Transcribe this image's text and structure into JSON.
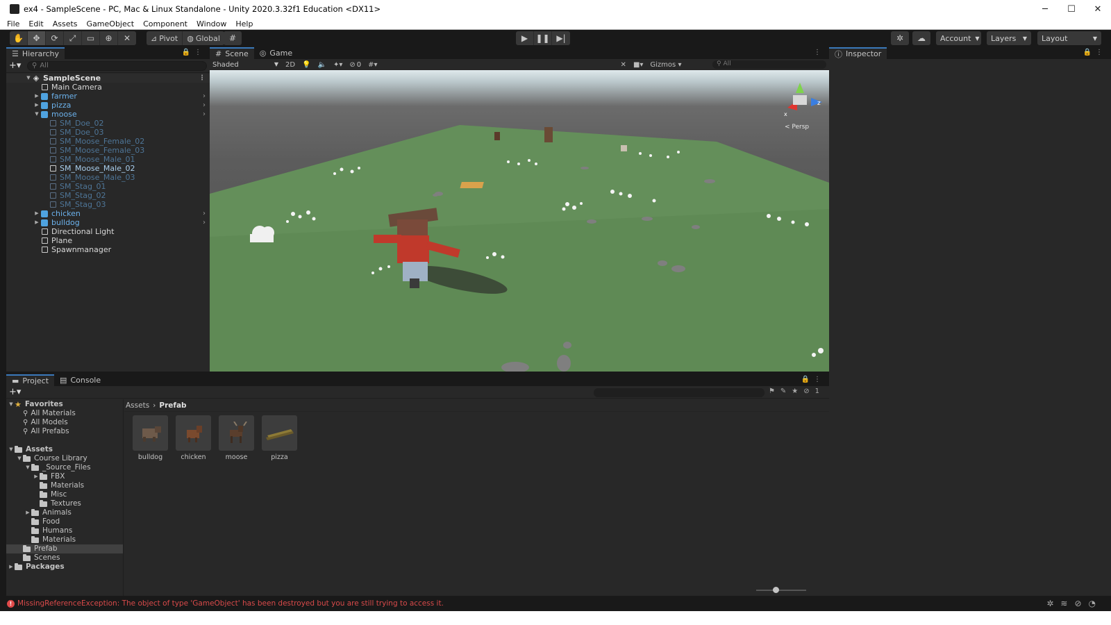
{
  "window": {
    "title": "ex4 - SampleScene - PC, Mac & Linux Standalone - Unity 2020.3.32f1 Education <DX11>",
    "controls": [
      "─",
      "☐",
      "✕"
    ]
  },
  "menubar": [
    "File",
    "Edit",
    "Assets",
    "GameObject",
    "Component",
    "Window",
    "Help"
  ],
  "toolbar": {
    "pivot_label": "Pivot",
    "global_label": "Global",
    "account_label": "Account",
    "layers_label": "Layers",
    "layout_label": "Layout"
  },
  "hierarchy": {
    "tab_label": "Hierarchy",
    "search_placeholder": "All",
    "scene_name": "SampleScene",
    "items": [
      {
        "label": "Main Camera",
        "style": "white"
      },
      {
        "label": "farmer",
        "style": "blue"
      },
      {
        "label": "pizza",
        "style": "blue"
      },
      {
        "label": "moose",
        "style": "blue"
      },
      {
        "label": "SM_Doe_02",
        "style": "faded"
      },
      {
        "label": "SM_Doe_03",
        "style": "faded"
      },
      {
        "label": "SM_Moose_Female_02",
        "style": "faded"
      },
      {
        "label": "SM_Moose_Female_03",
        "style": "faded"
      },
      {
        "label": "SM_Moose_Male_01",
        "style": "faded"
      },
      {
        "label": "SM_Moose_Male_02",
        "style": "bright"
      },
      {
        "label": "SM_Moose_Male_03",
        "style": "faded"
      },
      {
        "label": "SM_Stag_01",
        "style": "faded"
      },
      {
        "label": "SM_Stag_02",
        "style": "faded"
      },
      {
        "label": "SM_Stag_03",
        "style": "faded"
      },
      {
        "label": "chicken",
        "style": "blue"
      },
      {
        "label": "bulldog",
        "style": "blue"
      },
      {
        "label": "Directional Light",
        "style": "white"
      },
      {
        "label": "Plane",
        "style": "white"
      },
      {
        "label": "Spawnmanager",
        "style": "white"
      }
    ]
  },
  "scene": {
    "tabs": [
      "Scene",
      "Game"
    ],
    "shading_mode": "Shaded",
    "mode_2d": "2D",
    "hidden_count": "0",
    "gizmos_label": "Gizmos",
    "search_placeholder": "All",
    "projection_label": "< Persp",
    "axis_labels": {
      "x": "x",
      "z": "z"
    }
  },
  "inspector": {
    "tab_label": "Inspector"
  },
  "project": {
    "tabs": [
      "Project",
      "Console"
    ],
    "badge_count": "1",
    "favorites_label": "Favorites",
    "favorites": [
      "All Materials",
      "All Models",
      "All Prefabs"
    ],
    "assets_label": "Assets",
    "folders": [
      {
        "label": "Course Library",
        "depth": 1,
        "arrow": "open"
      },
      {
        "label": "_Source_Files",
        "depth": 2,
        "arrow": "open"
      },
      {
        "label": "FBX",
        "depth": 3,
        "arrow": "closed"
      },
      {
        "label": "Materials",
        "depth": 3,
        "arrow": "none"
      },
      {
        "label": "Misc",
        "depth": 3,
        "arrow": "none"
      },
      {
        "label": "Textures",
        "depth": 3,
        "arrow": "none"
      },
      {
        "label": "Animals",
        "depth": 2,
        "arrow": "closed"
      },
      {
        "label": "Food",
        "depth": 2,
        "arrow": "none"
      },
      {
        "label": "Humans",
        "depth": 2,
        "arrow": "none"
      },
      {
        "label": "Materials",
        "depth": 2,
        "arrow": "none"
      },
      {
        "label": "Prefab",
        "depth": 1,
        "arrow": "none",
        "selected": true
      },
      {
        "label": "Scenes",
        "depth": 1,
        "arrow": "none"
      }
    ],
    "packages_label": "Packages",
    "breadcrumb": [
      "Assets",
      "Prefab"
    ],
    "assets": [
      "bulldog",
      "chicken",
      "moose",
      "pizza"
    ]
  },
  "statusbar": {
    "error_message": "MissingReferenceException: The object of type 'GameObject' has been destroyed but you are still trying to access it."
  },
  "colors": {
    "accent": "#3a79bb",
    "ground": "#5f8a55",
    "error": "#d94a4a",
    "prefab_blue": "#6cb2ec"
  }
}
